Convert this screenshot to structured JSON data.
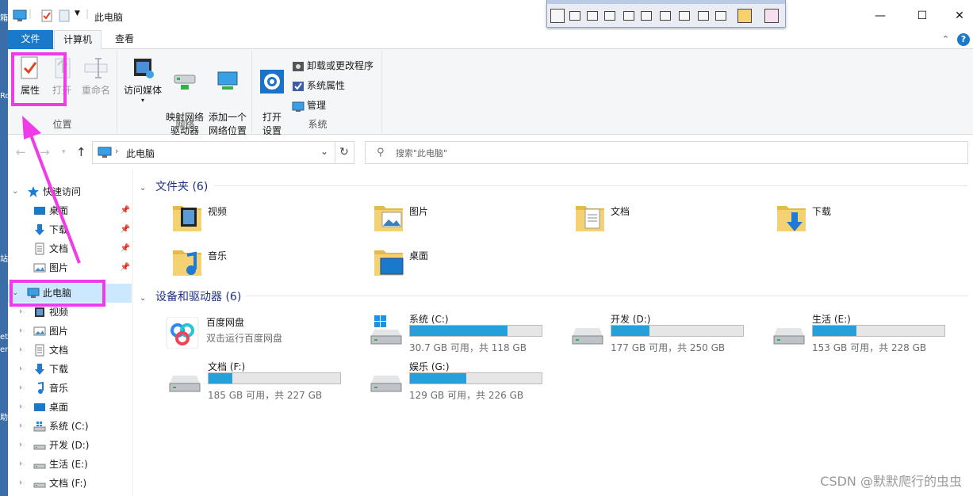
{
  "window": {
    "title": "此电脑",
    "controls": {
      "minimize": "—",
      "maximize": "☐",
      "close": "✕"
    }
  },
  "desktop_edge": [
    "箱",
    "Ro",
    "et",
    "er",
    "站",
    "助"
  ],
  "ribbon": {
    "tabs": [
      {
        "label": "文件",
        "active": false
      },
      {
        "label": "计算机",
        "active": true
      },
      {
        "label": "查看",
        "active": false
      }
    ],
    "groups": {
      "location": {
        "label": "位置",
        "buttons": [
          {
            "label": "属性",
            "enabled": true
          },
          {
            "label": "打开",
            "enabled": false
          },
          {
            "label": "重命名",
            "enabled": false
          }
        ]
      },
      "network": {
        "label": "网络",
        "buttons": [
          {
            "label": "访问媒体"
          },
          {
            "label": "映射网络\n驱动器"
          },
          {
            "label": "添加一个\n网络位置"
          }
        ]
      },
      "system": {
        "label": "系统",
        "open_settings": "打开\n设置",
        "small": [
          {
            "label": "卸载或更改程序"
          },
          {
            "label": "系统属性"
          },
          {
            "label": "管理"
          }
        ]
      }
    }
  },
  "address": {
    "path": "此电脑",
    "search_placeholder": "搜索\"此电脑\""
  },
  "nav": {
    "quick_access": "快速访问",
    "quick_items": [
      "桌面",
      "下载",
      "文档",
      "图片"
    ],
    "this_pc": "此电脑",
    "pc_items": [
      "视频",
      "图片",
      "文档",
      "下载",
      "音乐",
      "桌面",
      "系统 (C:)",
      "开发 (D:)",
      "生活 (E:)",
      "文档 (F:)"
    ]
  },
  "content": {
    "folders_header": "文件夹 (6)",
    "folders": [
      "视频",
      "图片",
      "文档",
      "下载",
      "音乐",
      "桌面"
    ],
    "devices_header": "设备和驱动器 (6)",
    "baidu": {
      "name": "百度网盘",
      "subtitle": "双击运行百度网盘"
    },
    "drives": [
      {
        "name": "系统 (C:)",
        "free": "30.7 GB 可用，共 118 GB",
        "used_fraction": 0.74
      },
      {
        "name": "开发 (D:)",
        "free": "177 GB 可用，共 250 GB",
        "used_fraction": 0.29
      },
      {
        "name": "生活 (E:)",
        "free": "153 GB 可用，共 228 GB",
        "used_fraction": 0.33
      },
      {
        "name": "文档 (F:)",
        "free": "185 GB 可用，共 227 GB",
        "used_fraction": 0.18
      },
      {
        "name": "娱乐 (G:)",
        "free": "129 GB 可用，共 226 GB",
        "used_fraction": 0.43
      }
    ]
  },
  "watermark": "CSDN @默默爬行的虫虫",
  "colors": {
    "accent": "#1979ca",
    "highlight": "#f03ce8",
    "drive_fill": "#26a0da",
    "selected": "#cce8ff",
    "folder": "#f4d172"
  }
}
